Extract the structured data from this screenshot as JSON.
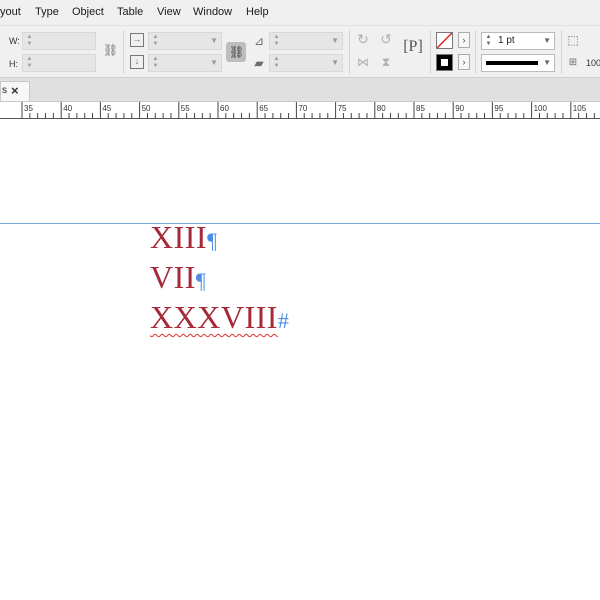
{
  "menu": {
    "items": [
      "yout",
      "Type",
      "Object",
      "Table",
      "View",
      "Window",
      "Help"
    ]
  },
  "control_panel": {
    "w_label": "W:",
    "h_label": "H:",
    "stroke_weight": "1 pt",
    "zoom_partial": "100"
  },
  "tab": {
    "partial_label": "s",
    "close_glyph": "×"
  },
  "ruler": {
    "labels": [
      "35",
      "40",
      "45",
      "50",
      "55",
      "60",
      "65",
      "70",
      "75",
      "80",
      "85",
      "90",
      "95",
      "100",
      "105"
    ]
  },
  "document": {
    "lines": [
      {
        "text": "XIII",
        "mark": "¶"
      },
      {
        "text": "VII",
        "mark": "¶"
      },
      {
        "text": "XXXVIII",
        "mark": "#"
      }
    ]
  },
  "colors": {
    "text": "#a52a3a",
    "hidden_chars": "#4a8ee6",
    "guide": "#7aa7e0",
    "spell_error": "#e03030"
  },
  "icons": {
    "fill_swatch": "none-swatch-icon",
    "stroke_swatch": "black-stroke-icon",
    "constrain": "chain-link-icon"
  }
}
